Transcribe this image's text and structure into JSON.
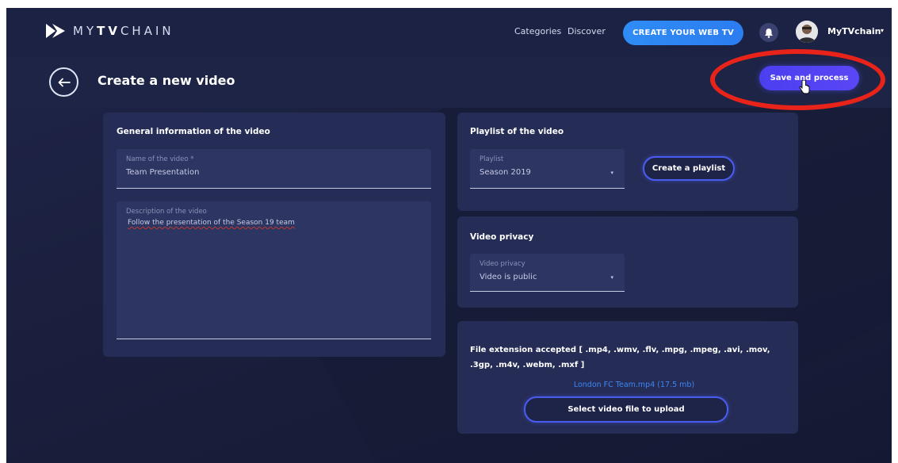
{
  "header": {
    "logo_text_prefix": "MY",
    "logo_text_bold": "TV",
    "logo_text_suffix": "CHAIN",
    "nav": [
      "Categories",
      "Discover"
    ],
    "cta_label": "CREATE YOUR WEB TV",
    "user_name": "MyTVchain",
    "user_caret": "▾"
  },
  "subheader": {
    "back_icon": "arrow-left-icon",
    "title": "Create a new video",
    "save_label": "Save and process"
  },
  "general": {
    "title": "General information of the video",
    "name_label": "Name of the video *",
    "name_value": "Team Presentation",
    "description_label": "Description of the video",
    "description_value": "Follow the presentation of the Season 19 team"
  },
  "playlist": {
    "title": "Playlist of the video",
    "select_label": "Playlist",
    "select_value": "Season 2019",
    "caret": "▾",
    "create_label": "Create a playlist"
  },
  "privacy": {
    "title": "Video privacy",
    "select_label": "Video privacy",
    "select_value": "Video is public",
    "caret": "▾"
  },
  "upload": {
    "extensions_text": "File extension accepted [ .mp4, .wmv, .flv, .mpg, .mpeg, .avi, .mov, .3gp, .m4v, .webm, .mxf ]",
    "file_name": "London FC Team.mp4 (17.5 mb)",
    "select_label": "Select video file to upload"
  },
  "colors": {
    "accent_blue": "#2f8cf5",
    "save_purple": "#4b3ff0",
    "highlight_red": "#e8231a",
    "link_blue": "#3d86f5"
  }
}
